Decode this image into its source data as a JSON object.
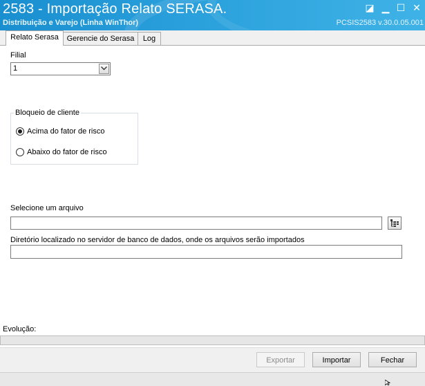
{
  "window": {
    "title": "2583 - Importação Relato SERASA.",
    "subtitle": "Distribuição e Varejo (Linha WinThor)",
    "version": "PCSIS2583  v.30.0.05.001",
    "controls": {
      "minimize": "▁",
      "maximize": "☐",
      "close": "✕",
      "extra": "◪"
    }
  },
  "tabs": [
    {
      "label": "Relato Serasa"
    },
    {
      "label": "Gerencie do Serasa"
    },
    {
      "label": "Log"
    }
  ],
  "form": {
    "filial_label": "Filial",
    "filial_value": "1",
    "bloqueio_legend": "Bloqueio de cliente",
    "radio_acima": "Acima do fator de risco",
    "radio_abaixo": "Abaixo do fator de risco",
    "arquivo_label": "Selecione um arquivo",
    "arquivo_value": "",
    "diretorio_label": "Diretório localizado no servidor de banco de dados, onde os arquivos serão importados",
    "diretorio_value": ""
  },
  "progress": {
    "label": "Evolução:",
    "value": 0
  },
  "buttons": {
    "exportar": "Exportar",
    "importar": "Importar",
    "fechar": "Fechar"
  },
  "colors": {
    "titlebar": "#1a8fd0",
    "accent": "#2aa0dc"
  }
}
